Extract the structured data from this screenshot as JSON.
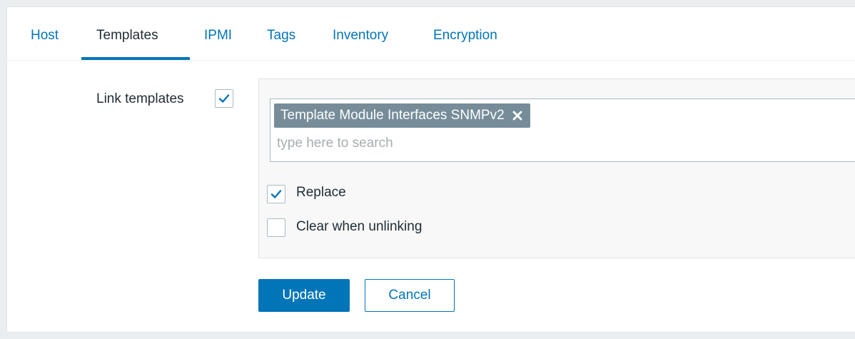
{
  "tabs": [
    {
      "label": "Host"
    },
    {
      "label": "Templates",
      "active": true
    },
    {
      "label": "IPMI"
    },
    {
      "label": "Tags"
    },
    {
      "label": "Inventory"
    },
    {
      "label": "Encryption"
    }
  ],
  "form": {
    "link_templates_label": "Link templates",
    "link_templates_checked": true,
    "selected_templates": [
      "Template Module Interfaces SNMPv2"
    ],
    "search_placeholder": "type here to search",
    "options": [
      {
        "label": "Replace",
        "checked": true
      },
      {
        "label": "Clear when unlinking",
        "checked": false
      }
    ]
  },
  "buttons": {
    "update": "Update",
    "cancel": "Cancel"
  },
  "colors": {
    "accent": "#0275b8",
    "tag_bg": "#768d99",
    "text": "#1f2c33",
    "background": "#ebeef0"
  },
  "icons": {
    "check": "check-icon",
    "remove": "close-icon"
  }
}
